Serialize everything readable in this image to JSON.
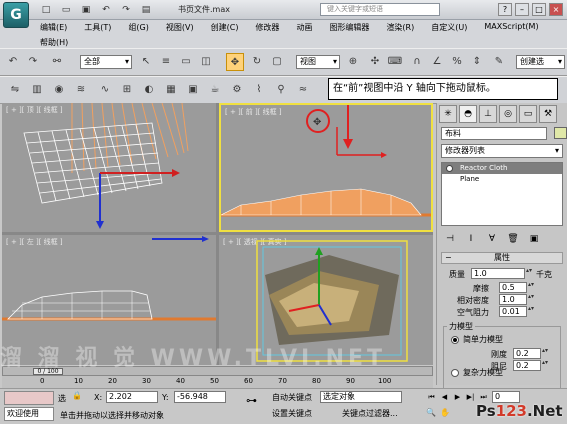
{
  "app": {
    "title": "书页文件.max",
    "search_placeholder": "键入关键字或短语",
    "logo_text": "G"
  },
  "menu": {
    "row1": [
      "编辑(E)",
      "工具(T)",
      "组(G)",
      "视图(V)",
      "创建(C)",
      "修改器",
      "动画",
      "图形编辑器",
      "渲染(R)",
      "自定义(U)",
      "MAXScript(M)"
    ],
    "row2": [
      "帮助(H)"
    ]
  },
  "toolbar": {
    "selection_filter": "全部",
    "ref_coord": "视图",
    "named_selection": "创建选"
  },
  "instruction": "在“前”视图中沿 Y 轴向下拖动鼠标。",
  "viewports": {
    "top_label": "[ + ][ 顶 ][ 线框 ]",
    "front_label": "[ + ][ 前 ][ 线框 ]",
    "left_label": "[ + ][ 左 ][ 线框 ]",
    "persp_label": "[ + ][ 透视 ][ 真实 ]"
  },
  "command_panel": {
    "object_name": "布料",
    "modifier_list": "修改器列表",
    "stack": [
      "Reactor Cloth",
      "Plane"
    ],
    "rollout_title": "属性",
    "params": {
      "mass_label": "质量",
      "mass_value": "1.0",
      "mass_unit": "千克",
      "friction_label": "摩擦",
      "friction_value": "0.5",
      "rel_density_label": "相对密度",
      "rel_density_value": "1.0",
      "air_resist_label": "空气阻力",
      "air_resist_value": "0.01"
    },
    "force_model": {
      "group_title": "力模型",
      "simple_label": "简单力模型",
      "stiffness_label": "刚度",
      "stiffness_value": "0.2",
      "damping_label": "阻尼",
      "damping_value": "0.2",
      "complex_label": "复杂力模型"
    }
  },
  "timeline": {
    "slider": "0 / 100",
    "ticks": [
      "0",
      "10",
      "20",
      "30",
      "40",
      "50",
      "60",
      "70",
      "80",
      "90",
      "100"
    ]
  },
  "status": {
    "welcome": "欢迎使用",
    "select_prefix": "选",
    "x_label": "X:",
    "x_value": "2.202",
    "y_label": "Y:",
    "y_value": "-56.948",
    "auto_key": "自动关键点",
    "set_key": "设置关键点",
    "selected_object": "选定对象",
    "key_filters": "关键点过滤器...",
    "prompt": "单击并拖动以选择并移动对象",
    "frame_value": "0"
  },
  "watermark": "溜 溜 视 觉  WWW.TLVI.NET",
  "brand": {
    "ps": "Ps",
    "num": "123",
    "net": ".Net"
  }
}
